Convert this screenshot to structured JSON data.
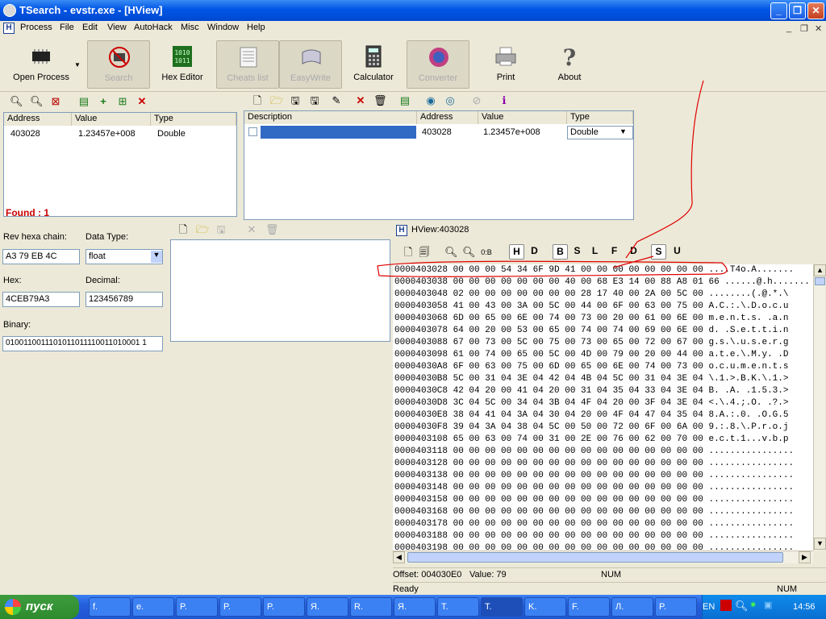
{
  "window": {
    "title": "TSearch - evstr.exe - [HView]"
  },
  "menu": [
    "Process",
    "File",
    "Edit",
    "View",
    "AutoHack",
    "Misc",
    "Window",
    "Help"
  ],
  "toolbar": [
    {
      "label": "Open Process",
      "icon": "chip-icon"
    },
    {
      "label": "Search",
      "icon": "no-search-icon",
      "state": "pressed-disabled"
    },
    {
      "label": "Hex Editor",
      "icon": "binary-icon"
    },
    {
      "label": "Cheats list",
      "icon": "list-icon",
      "state": "pressed-disabled"
    },
    {
      "label": "EasyWrite",
      "icon": "scroll-icon",
      "state": "pressed-disabled"
    },
    {
      "label": "Calculator",
      "icon": "calculator-icon"
    },
    {
      "label": "Converter",
      "icon": "converter-icon",
      "state": "pressed-disabled"
    },
    {
      "label": "Print",
      "icon": "printer-icon"
    },
    {
      "label": "About",
      "icon": "question-icon"
    }
  ],
  "results": {
    "headers": [
      "Address",
      "Value",
      "Type"
    ],
    "rows": [
      {
        "address": "403028",
        "value": "1.23457e+008",
        "type": "Double"
      }
    ],
    "found": "Found : 1"
  },
  "cheats": {
    "headers": [
      "Description",
      "Address",
      "Value",
      "Type"
    ],
    "rows": [
      {
        "description": "",
        "address": "403028",
        "value": "1.23457e+008",
        "type": "Double"
      }
    ]
  },
  "converter": {
    "rev_hexa_label": "Rev hexa chain:",
    "rev_hexa_value": "A3 79 EB 4C",
    "data_type_label": "Data Type:",
    "data_type_value": "float",
    "hex_label": "Hex:",
    "hex_value": "4CEB79A3",
    "decimal_label": "Decimal:",
    "decimal_value": "123456789",
    "binary_label": "Binary:",
    "binary_value": "0100110011101011011110011010001 1"
  },
  "hview": {
    "title": "HView:403028",
    "mode_buttons": [
      "H",
      "D",
      "B",
      "S",
      "L",
      "F",
      "D",
      "S",
      "U"
    ],
    "lines": [
      "0000403028 00 00 00 54 34 6F 9D 41 00 00 00 00 00 00 00 00 ....T4o.A.......",
      "0000403038 00 00 00 00 00 00 00 40 00 68 E3 14 00 88 A8 01 66 ......@.h.......",
      "0000403048 02 00 00 00 00 00 00 00 28 17 40 00 2A 00 5C 00 ........(.@.*.\\",
      "0000403058 41 00 43 00 3A 00 5C 00 44 00 6F 00 63 00 75 00 A.C.:.\\.D.o.c.u",
      "0000403068 6D 00 65 00 6E 00 74 00 73 00 20 00 61 00 6E 00 m.e.n.t.s. .a.n",
      "0000403078 64 00 20 00 53 00 65 00 74 00 74 00 69 00 6E 00 d. .S.e.t.t.i.n",
      "0000403088 67 00 73 00 5C 00 75 00 73 00 65 00 72 00 67 00 g.s.\\.u.s.e.r.g",
      "0000403098 61 00 74 00 65 00 5C 00 4D 00 79 00 20 00 44 00 a.t.e.\\.M.y. .D",
      "00004030A8 6F 00 63 00 75 00 6D 00 65 00 6E 00 74 00 73 00 o.c.u.m.e.n.t.s",
      "00004030B8 5C 00 31 04 3E 04 42 04 4B 04 5C 00 31 04 3E 04 \\.1.>.B.K.\\.1.>",
      "00004030C8 42 04 20 00 41 04 20 00 31 04 35 04 33 04 3E 04 B. .A. .1.5.3.>",
      "00004030D8 3C 04 5C 00 34 04 3B 04 4F 04 20 00 3F 04 3E 04 <.\\.4.;.O. .?.>",
      "00004030E8 38 04 41 04 3A 04 30 04 20 00 4F 04 47 04 35 04 8.A.:.0. .O.G.5",
      "00004030F8 39 04 3A 04 38 04 5C 00 50 00 72 00 6F 00 6A 00 9.:.8.\\.P.r.o.j",
      "0000403108 65 00 63 00 74 00 31 00 2E 00 76 00 62 00 70 00 e.c.t.1...v.b.p",
      "0000403118 00 00 00 00 00 00 00 00 00 00 00 00 00 00 00 00 ................",
      "0000403128 00 00 00 00 00 00 00 00 00 00 00 00 00 00 00 00 ................",
      "0000403138 00 00 00 00 00 00 00 00 00 00 00 00 00 00 00 00 ................",
      "0000403148 00 00 00 00 00 00 00 00 00 00 00 00 00 00 00 00 ................",
      "0000403158 00 00 00 00 00 00 00 00 00 00 00 00 00 00 00 00 ................",
      "0000403168 00 00 00 00 00 00 00 00 00 00 00 00 00 00 00 00 ................",
      "0000403178 00 00 00 00 00 00 00 00 00 00 00 00 00 00 00 00 ................",
      "0000403188 00 00 00 00 00 00 00 00 00 00 00 00 00 00 00 00 ................",
      "0000403198 00 00 00 00 00 00 00 00 00 00 00 00 00 00 00 00 ................"
    ],
    "offset": "Offset: 004030E0",
    "value": "Value: 79",
    "num": "NUM"
  },
  "status": {
    "text": "Ready",
    "num": "NUM"
  },
  "taskbar": {
    "start": "пуск",
    "tasks": [
      "f.",
      "e.",
      "P.",
      "P.",
      "P.",
      "Я.",
      "R.",
      "Я.",
      "T.",
      "T.",
      "K.",
      "F.",
      "Л.",
      "P."
    ],
    "lang": "EN",
    "clock": "14:56"
  }
}
